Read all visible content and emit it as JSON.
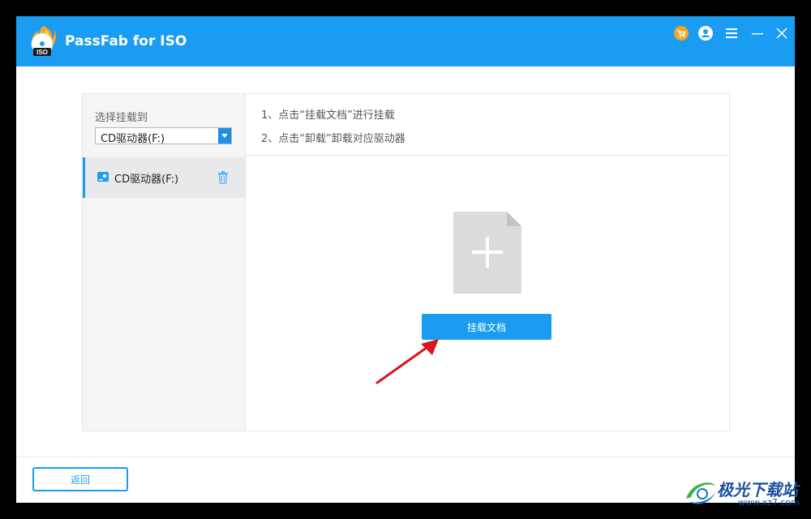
{
  "titlebar": {
    "title": "PassFab for ISO",
    "icons": [
      "cart-icon",
      "user-icon",
      "menu-icon",
      "minimize-icon",
      "close-icon"
    ],
    "bg_color": "#1b9cf3"
  },
  "sidebar": {
    "select_label": "选择挂载到",
    "select_value": "CD驱动器(F:)",
    "drive_item_label": "CD驱动器(F:)"
  },
  "instructions": {
    "step1": "1、点击“挂载文档”进行挂载",
    "step2": "2、点击“卸载”卸载对应驱动器"
  },
  "main": {
    "mount_button": "挂载文档"
  },
  "footer": {
    "back_button": "返回"
  },
  "watermark": {
    "text": "极光下载站",
    "url": "www.xz7.com"
  },
  "colors": {
    "accent": "#1b9cf3",
    "annotation_arrow": "#d9161c"
  }
}
